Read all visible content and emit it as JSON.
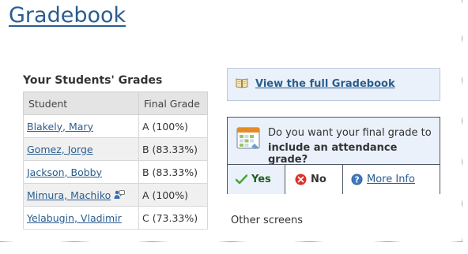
{
  "page": {
    "title": "Gradebook"
  },
  "grades": {
    "heading": "Your Students' Grades",
    "columns": [
      "Student",
      "Final Grade"
    ],
    "rows": [
      {
        "student": "Blakely, Mary",
        "grade": "A (100%)"
      },
      {
        "student": "Gomez, Jorge",
        "grade": "B (83.33%)"
      },
      {
        "student": "Jackson, Bobby",
        "grade": "B (83.33%)"
      },
      {
        "student": "Mimura, Machiko",
        "grade": "A (100%)",
        "icon": "message-icon"
      },
      {
        "student": "Yelabugin, Vladimir",
        "grade": "C (73.33%)"
      }
    ]
  },
  "gradebook_box": {
    "link": "View the full Gradebook",
    "icon": "book-icon"
  },
  "attendance_box": {
    "question_line1": "Do you want your final grade to",
    "question_line2": "include an attendance grade?",
    "icon": "calendar-icon",
    "yes": "Yes",
    "no": "No",
    "more": "More Info"
  },
  "other_screens": "Other screens",
  "colors": {
    "link": "#2a5d8f",
    "box_bg": "#eaf1fa",
    "yes_green": "#1f5f1f"
  }
}
